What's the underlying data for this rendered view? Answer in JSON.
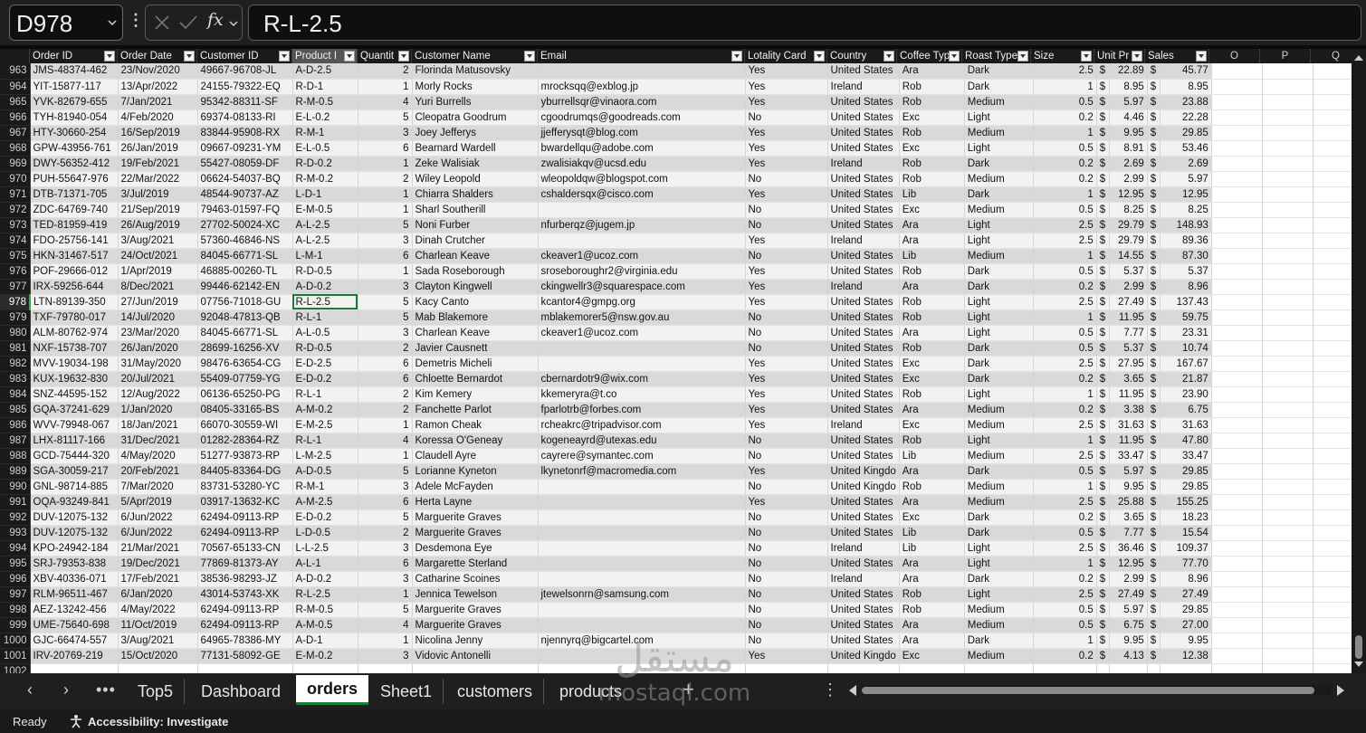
{
  "formula_bar": {
    "cell_ref": "D978",
    "formula": "R-L-2.5",
    "fx_label": "fx"
  },
  "columns": [
    {
      "label": "Order ID",
      "filter": true
    },
    {
      "label": "Order Date",
      "filter": true
    },
    {
      "label": "Customer ID",
      "filter": true
    },
    {
      "label": "Product I",
      "filter": true
    },
    {
      "label": "Quantit",
      "filter": true
    },
    {
      "label": "Customer Name",
      "filter": true
    },
    {
      "label": "Email",
      "filter": true
    },
    {
      "label": "Lotality Card",
      "filter": true
    },
    {
      "label": "Country",
      "filter": true
    },
    {
      "label": "Coffee Typ",
      "filter": true
    },
    {
      "label": "Roast Type",
      "filter": true
    },
    {
      "label": "Size",
      "filter": true
    },
    {
      "label": "Unit Pr",
      "filter": true
    },
    {
      "label": "Sales",
      "filter": true
    },
    {
      "label": "O",
      "filter": false
    },
    {
      "label": "P",
      "filter": false
    },
    {
      "label": "Q",
      "filter": false
    }
  ],
  "rows": [
    [
      "963",
      "JMS-48374-462",
      "23/Nov/2020",
      "49667-96708-JL",
      "A-D-2.5",
      "2",
      "Florinda Matusovsky",
      "",
      "Yes",
      "United States",
      "Ara",
      "Dark",
      "2.5",
      "$",
      "22.89",
      "$",
      "45.77"
    ],
    [
      "964",
      "YIT-15877-117",
      "13/Apr/2022",
      "24155-79322-EQ",
      "R-D-1",
      "1",
      "Morly Rocks",
      "mrocksqq@exblog.jp",
      "Yes",
      "Ireland",
      "Rob",
      "Dark",
      "1",
      "$",
      "8.95",
      "$",
      "8.95"
    ],
    [
      "965",
      "YVK-82679-655",
      "7/Jan/2021",
      "95342-88311-SF",
      "R-M-0.5",
      "4",
      "Yuri Burrells",
      "yburrellsqr@vinaora.com",
      "Yes",
      "United States",
      "Rob",
      "Medium",
      "0.5",
      "$",
      "5.97",
      "$",
      "23.88"
    ],
    [
      "966",
      "TYH-81940-054",
      "4/Feb/2020",
      "69374-08133-RI",
      "E-L-0.2",
      "5",
      "Cleopatra Goodrum",
      "cgoodrumqs@goodreads.com",
      "No",
      "United States",
      "Exc",
      "Light",
      "0.2",
      "$",
      "4.46",
      "$",
      "22.28"
    ],
    [
      "967",
      "HTY-30660-254",
      "16/Sep/2019",
      "83844-95908-RX",
      "R-M-1",
      "3",
      "Joey Jefferys",
      "jjefferysqt@blog.com",
      "Yes",
      "United States",
      "Rob",
      "Medium",
      "1",
      "$",
      "9.95",
      "$",
      "29.85"
    ],
    [
      "968",
      "GPW-43956-761",
      "26/Jan/2019",
      "09667-09231-YM",
      "E-L-0.5",
      "6",
      "Bearnard Wardell",
      "bwardellqu@adobe.com",
      "Yes",
      "United States",
      "Exc",
      "Light",
      "0.5",
      "$",
      "8.91",
      "$",
      "53.46"
    ],
    [
      "969",
      "DWY-56352-412",
      "19/Feb/2021",
      "55427-08059-DF",
      "R-D-0.2",
      "1",
      "Zeke Walisiak",
      "zwalisiakqv@ucsd.edu",
      "Yes",
      "Ireland",
      "Rob",
      "Dark",
      "0.2",
      "$",
      "2.69",
      "$",
      "2.69"
    ],
    [
      "970",
      "PUH-55647-976",
      "22/Mar/2022",
      "06624-54037-BQ",
      "R-M-0.2",
      "2",
      "Wiley Leopold",
      "wleopoldqw@blogspot.com",
      "No",
      "United States",
      "Rob",
      "Medium",
      "0.2",
      "$",
      "2.99",
      "$",
      "5.97"
    ],
    [
      "971",
      "DTB-71371-705",
      "3/Jul/2019",
      "48544-90737-AZ",
      "L-D-1",
      "1",
      "Chiarra Shalders",
      "cshaldersqx@cisco.com",
      "Yes",
      "United States",
      "Lib",
      "Dark",
      "1",
      "$",
      "12.95",
      "$",
      "12.95"
    ],
    [
      "972",
      "ZDC-64769-740",
      "21/Sep/2019",
      "79463-01597-FQ",
      "E-M-0.5",
      "1",
      "Sharl Southerill",
      "",
      "No",
      "United States",
      "Exc",
      "Medium",
      "0.5",
      "$",
      "8.25",
      "$",
      "8.25"
    ],
    [
      "973",
      "TED-81959-419",
      "26/Aug/2019",
      "27702-50024-XC",
      "A-L-2.5",
      "5",
      "Noni Furber",
      "nfurberqz@jugem.jp",
      "No",
      "United States",
      "Ara",
      "Light",
      "2.5",
      "$",
      "29.79",
      "$",
      "148.93"
    ],
    [
      "974",
      "FDO-25756-141",
      "3/Aug/2021",
      "57360-46846-NS",
      "A-L-2.5",
      "3",
      "Dinah Crutcher",
      "",
      "Yes",
      "Ireland",
      "Ara",
      "Light",
      "2.5",
      "$",
      "29.79",
      "$",
      "89.36"
    ],
    [
      "975",
      "HKN-31467-517",
      "24/Oct/2021",
      "84045-66771-SL",
      "L-M-1",
      "6",
      "Charlean Keave",
      "ckeaver1@ucoz.com",
      "No",
      "United States",
      "Lib",
      "Medium",
      "1",
      "$",
      "14.55",
      "$",
      "87.30"
    ],
    [
      "976",
      "POF-29666-012",
      "1/Apr/2019",
      "46885-00260-TL",
      "R-D-0.5",
      "1",
      "Sada Roseborough",
      "sroseboroughr2@virginia.edu",
      "Yes",
      "United States",
      "Rob",
      "Dark",
      "0.5",
      "$",
      "5.37",
      "$",
      "5.37"
    ],
    [
      "977",
      "IRX-59256-644",
      "8/Dec/2021",
      "99446-62142-EN",
      "A-D-0.2",
      "3",
      "Clayton Kingwell",
      "ckingwellr3@squarespace.com",
      "Yes",
      "Ireland",
      "Ara",
      "Dark",
      "0.2",
      "$",
      "2.99",
      "$",
      "8.96"
    ],
    [
      "978",
      "LTN-89139-350",
      "27/Jun/2019",
      "07756-71018-GU",
      "R-L-2.5",
      "5",
      "Kacy Canto",
      "kcantor4@gmpg.org",
      "Yes",
      "United States",
      "Rob",
      "Light",
      "2.5",
      "$",
      "27.49",
      "$",
      "137.43"
    ],
    [
      "979",
      "TXF-79780-017",
      "14/Jul/2020",
      "92048-47813-QB",
      "R-L-1",
      "5",
      "Mab Blakemore",
      "mblakemorer5@nsw.gov.au",
      "No",
      "United States",
      "Rob",
      "Light",
      "1",
      "$",
      "11.95",
      "$",
      "59.75"
    ],
    [
      "980",
      "ALM-80762-974",
      "23/Mar/2020",
      "84045-66771-SL",
      "A-L-0.5",
      "3",
      "Charlean Keave",
      "ckeaver1@ucoz.com",
      "No",
      "United States",
      "Ara",
      "Light",
      "0.5",
      "$",
      "7.77",
      "$",
      "23.31"
    ],
    [
      "981",
      "NXF-15738-707",
      "26/Jan/2020",
      "28699-16256-XV",
      "R-D-0.5",
      "2",
      "Javier Causnett",
      "",
      "No",
      "United States",
      "Rob",
      "Dark",
      "0.5",
      "$",
      "5.37",
      "$",
      "10.74"
    ],
    [
      "982",
      "MVV-19034-198",
      "31/May/2020",
      "98476-63654-CG",
      "E-D-2.5",
      "6",
      "Demetris Micheli",
      "",
      "Yes",
      "United States",
      "Exc",
      "Dark",
      "2.5",
      "$",
      "27.95",
      "$",
      "167.67"
    ],
    [
      "983",
      "KUX-19632-830",
      "20/Jul/2021",
      "55409-07759-YG",
      "E-D-0.2",
      "6",
      "Chloette Bernardot",
      "cbernardotr9@wix.com",
      "Yes",
      "United States",
      "Exc",
      "Dark",
      "0.2",
      "$",
      "3.65",
      "$",
      "21.87"
    ],
    [
      "984",
      "SNZ-44595-152",
      "12/Aug/2022",
      "06136-65250-PG",
      "R-L-1",
      "2",
      "Kim Kemery",
      "kkemeryra@t.co",
      "Yes",
      "United States",
      "Rob",
      "Light",
      "1",
      "$",
      "11.95",
      "$",
      "23.90"
    ],
    [
      "985",
      "GQA-37241-629",
      "1/Jan/2020",
      "08405-33165-BS",
      "A-M-0.2",
      "2",
      "Fanchette Parlot",
      "fparlotrb@forbes.com",
      "Yes",
      "United States",
      "Ara",
      "Medium",
      "0.2",
      "$",
      "3.38",
      "$",
      "6.75"
    ],
    [
      "986",
      "WVV-79948-067",
      "18/Jan/2021",
      "66070-30559-WI",
      "E-M-2.5",
      "1",
      "Ramon Cheak",
      "rcheakrc@tripadvisor.com",
      "Yes",
      "Ireland",
      "Exc",
      "Medium",
      "2.5",
      "$",
      "31.63",
      "$",
      "31.63"
    ],
    [
      "987",
      "LHX-81117-166",
      "31/Dec/2021",
      "01282-28364-RZ",
      "R-L-1",
      "4",
      "Koressa O'Geneay",
      "kogeneayrd@utexas.edu",
      "No",
      "United States",
      "Rob",
      "Light",
      "1",
      "$",
      "11.95",
      "$",
      "47.80"
    ],
    [
      "988",
      "GCD-75444-320",
      "4/May/2020",
      "51277-93873-RP",
      "L-M-2.5",
      "1",
      "Claudell Ayre",
      "cayrere@symantec.com",
      "No",
      "United States",
      "Lib",
      "Medium",
      "2.5",
      "$",
      "33.47",
      "$",
      "33.47"
    ],
    [
      "989",
      "SGA-30059-217",
      "20/Feb/2021",
      "84405-83364-DG",
      "A-D-0.5",
      "5",
      "Lorianne Kyneton",
      "lkynetonrf@macromedia.com",
      "Yes",
      "United Kingdo",
      "Ara",
      "Dark",
      "0.5",
      "$",
      "5.97",
      "$",
      "29.85"
    ],
    [
      "990",
      "GNL-98714-885",
      "7/Mar/2020",
      "83731-53280-YC",
      "R-M-1",
      "3",
      "Adele McFayden",
      "",
      "No",
      "United Kingdo",
      "Rob",
      "Medium",
      "1",
      "$",
      "9.95",
      "$",
      "29.85"
    ],
    [
      "991",
      "OQA-93249-841",
      "5/Apr/2019",
      "03917-13632-KC",
      "A-M-2.5",
      "6",
      "Herta Layne",
      "",
      "Yes",
      "United States",
      "Ara",
      "Medium",
      "2.5",
      "$",
      "25.88",
      "$",
      "155.25"
    ],
    [
      "992",
      "DUV-12075-132",
      "6/Jun/2022",
      "62494-09113-RP",
      "E-D-0.2",
      "5",
      "Marguerite Graves",
      "",
      "No",
      "United States",
      "Exc",
      "Dark",
      "0.2",
      "$",
      "3.65",
      "$",
      "18.23"
    ],
    [
      "993",
      "DUV-12075-132",
      "6/Jun/2022",
      "62494-09113-RP",
      "L-D-0.5",
      "2",
      "Marguerite Graves",
      "",
      "No",
      "United States",
      "Lib",
      "Dark",
      "0.5",
      "$",
      "7.77",
      "$",
      "15.54"
    ],
    [
      "994",
      "KPO-24942-184",
      "21/Mar/2021",
      "70567-65133-CN",
      "L-L-2.5",
      "3",
      "Desdemona Eye",
      "",
      "No",
      "Ireland",
      "Lib",
      "Light",
      "2.5",
      "$",
      "36.46",
      "$",
      "109.37"
    ],
    [
      "995",
      "SRJ-79353-838",
      "19/Dec/2021",
      "77869-81373-AY",
      "A-L-1",
      "6",
      "Margarette Sterland",
      "",
      "No",
      "United States",
      "Ara",
      "Light",
      "1",
      "$",
      "12.95",
      "$",
      "77.70"
    ],
    [
      "996",
      "XBV-40336-071",
      "17/Feb/2021",
      "38536-98293-JZ",
      "A-D-0.2",
      "3",
      "Catharine Scoines",
      "",
      "No",
      "Ireland",
      "Ara",
      "Dark",
      "0.2",
      "$",
      "2.99",
      "$",
      "8.96"
    ],
    [
      "997",
      "RLM-96511-467",
      "6/Jan/2020",
      "43014-53743-XK",
      "R-L-2.5",
      "1",
      "Jennica Tewelson",
      "jtewelsonrn@samsung.com",
      "No",
      "United States",
      "Rob",
      "Light",
      "2.5",
      "$",
      "27.49",
      "$",
      "27.49"
    ],
    [
      "998",
      "AEZ-13242-456",
      "4/May/2022",
      "62494-09113-RP",
      "R-M-0.5",
      "5",
      "Marguerite Graves",
      "",
      "No",
      "United States",
      "Rob",
      "Medium",
      "0.5",
      "$",
      "5.97",
      "$",
      "29.85"
    ],
    [
      "999",
      "UME-75640-698",
      "11/Oct/2019",
      "62494-09113-RP",
      "A-M-0.5",
      "4",
      "Marguerite Graves",
      "",
      "No",
      "United States",
      "Ara",
      "Medium",
      "0.5",
      "$",
      "6.75",
      "$",
      "27.00"
    ],
    [
      "1000",
      "GJC-66474-557",
      "3/Aug/2021",
      "64965-78386-MY",
      "A-D-1",
      "1",
      "Nicolina Jenny",
      "njennyrq@bigcartel.com",
      "No",
      "United States",
      "Ara",
      "Dark",
      "1",
      "$",
      "9.95",
      "$",
      "9.95"
    ],
    [
      "1001",
      "IRV-20769-219",
      "15/Oct/2020",
      "77131-58092-GE",
      "E-M-0.2",
      "3",
      "Vidovic Antonelli",
      "",
      "Yes",
      "United Kingdo",
      "Exc",
      "Medium",
      "0.2",
      "$",
      "4.13",
      "$",
      "12.38"
    ],
    [
      "1002",
      "",
      "",
      "",
      "",
      "",
      "",
      "",
      "",
      "",
      "",
      "",
      "",
      "",
      "",
      "",
      ""
    ]
  ],
  "active_row": "978",
  "sheet_tabs": [
    {
      "label": "Top5",
      "active": false
    },
    {
      "label": "Dashboard",
      "active": false
    },
    {
      "label": "orders",
      "active": true
    },
    {
      "label": "Sheet1",
      "active": false
    },
    {
      "label": "customers",
      "active": false
    },
    {
      "label": "products",
      "active": false
    }
  ],
  "status": {
    "ready": "Ready",
    "accessibility": "Accessibility: Investigate"
  },
  "watermark": {
    "arabic": "مستقل",
    "latin": "mostaql.com"
  },
  "colors": {
    "accent": "#1f7a3a",
    "header_bg": "#1a1a1a",
    "band_dark": "#d9d9d9",
    "band_light": "#f2f2f2"
  }
}
